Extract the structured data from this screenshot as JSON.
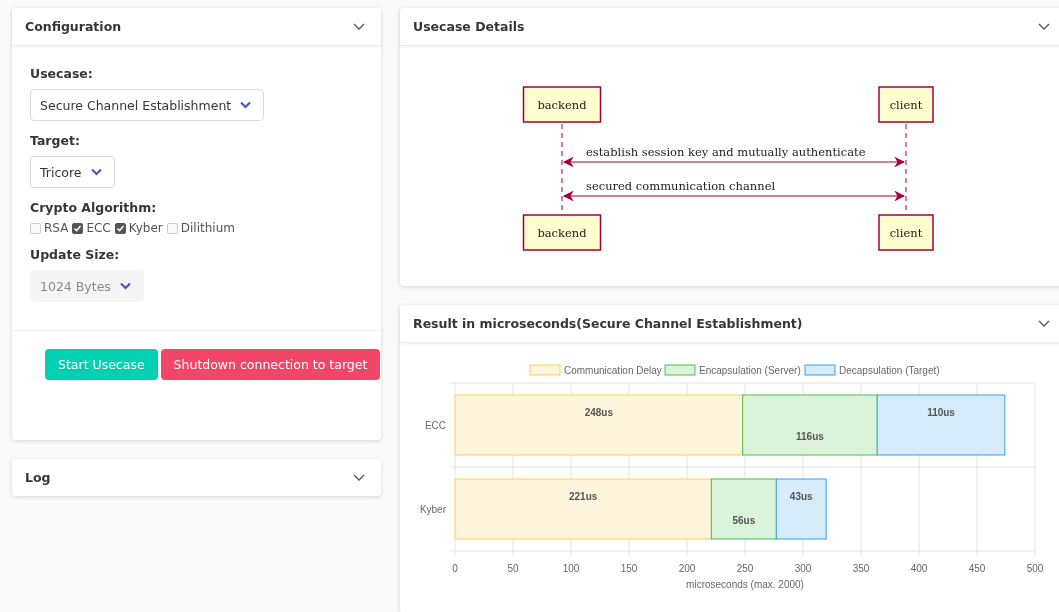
{
  "configuration": {
    "title": "Configuration",
    "expanded": true,
    "usecase": {
      "label": "Usecase:",
      "value": "Secure Channel Establishment",
      "disabled": false
    },
    "target": {
      "label": "Target:",
      "value": "Tricore",
      "disabled": false
    },
    "algorithms": {
      "label": "Crypto Algorithm:",
      "options": [
        {
          "label": "RSA",
          "checked": false
        },
        {
          "label": "ECC",
          "checked": true
        },
        {
          "label": "Kyber",
          "checked": true
        },
        {
          "label": "Dilithium",
          "checked": false
        }
      ]
    },
    "update_size": {
      "label": "Update Size:",
      "value": "1024 Bytes",
      "disabled": true
    },
    "buttons": [
      {
        "label": "Start Usecase",
        "kind": "primary"
      },
      {
        "label": "Shutdown connection to target",
        "kind": "danger"
      }
    ]
  },
  "log": {
    "title": "Log",
    "expanded": false
  },
  "usecase_details": {
    "title": "Usecase Details",
    "expanded": true,
    "top_participants": [
      "backend",
      "client"
    ],
    "bottom_participants": [
      "backend",
      "client"
    ],
    "messages": [
      "establish session key and mutually authenticate",
      "secured communication channel"
    ]
  },
  "result": {
    "title": "Result in microseconds(Secure Channel Establishment)",
    "expanded": true,
    "chart_data": {
      "type": "bar",
      "orientation": "horizontal",
      "stacked": true,
      "xlabel": "microseconds (max. 2000)",
      "categories": [
        "ECC",
        "Kyber"
      ],
      "series": [
        {
          "name": "Communication Delay",
          "color": "#ffcd56",
          "values": [
            248,
            221
          ]
        },
        {
          "name": "Encapsulation (Server)",
          "color": "#4bc04b",
          "values": [
            116,
            56
          ]
        },
        {
          "name": "Decapsulation (Target)",
          "color": "#36a2eb",
          "values": [
            110,
            43
          ]
        }
      ],
      "grid": true,
      "legend": true,
      "xlim": [
        0,
        500
      ],
      "xticks": [
        0,
        50,
        100,
        150,
        200,
        250,
        300,
        350,
        400,
        450,
        500
      ],
      "value_labels": [
        [
          "248us",
          "221us"
        ],
        [
          "116us",
          "56us"
        ],
        [
          "110us",
          "43us"
        ]
      ]
    }
  }
}
